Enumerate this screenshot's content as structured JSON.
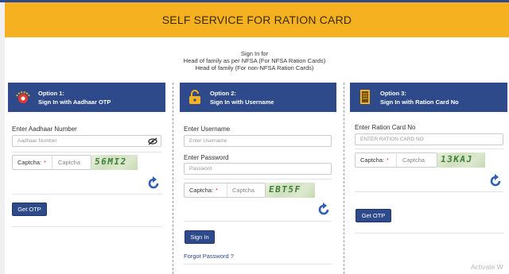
{
  "header": {
    "title": "SELF SERVICE FOR RATION CARD"
  },
  "intro": {
    "line1": "Sign In for",
    "line2": "Head of family as per NFSA (For NFSA Ration Cards)",
    "line3": "Head of family (For non-NFSA Ration Cards)"
  },
  "option1": {
    "title": "Option 1:",
    "subtitle": "Sign In with Aadhaar OTP",
    "field_label": "Enter Aadhaar Number",
    "field_placeholder": "Aadhaar Number",
    "captcha_label": "Captcha:",
    "captcha_star": "*",
    "captcha_placeholder": "Captcha",
    "captcha_code": "56MI2",
    "button": "Get OTP"
  },
  "option2": {
    "title": "Option 2:",
    "subtitle": "Sign In with Username",
    "username_label": "Enter Username",
    "username_placeholder": "Enter Username",
    "password_label": "Enter Password",
    "password_placeholder": "Password",
    "captcha_label": "Captcha:",
    "captcha_star": "*",
    "captcha_placeholder": "Captcha",
    "captcha_code": "EBT5F",
    "button": "Sign In",
    "forgot": "Forgot Password ?"
  },
  "option3": {
    "title": "Option 3:",
    "subtitle": "Sign In with Ration Card No",
    "field_label": "Enter Ration Card No",
    "field_placeholder": "ENTER RATION CARD NO",
    "captcha_label": "Captcha:",
    "captcha_star": "*",
    "captcha_placeholder": "Captcha",
    "captcha_code": "13KAJ",
    "button": "Get OTP"
  },
  "watermark": "Activate W",
  "colors": {
    "banner": "#f5b120",
    "primary": "#2e4a8a",
    "captcha_text": "#3e7e3b"
  }
}
